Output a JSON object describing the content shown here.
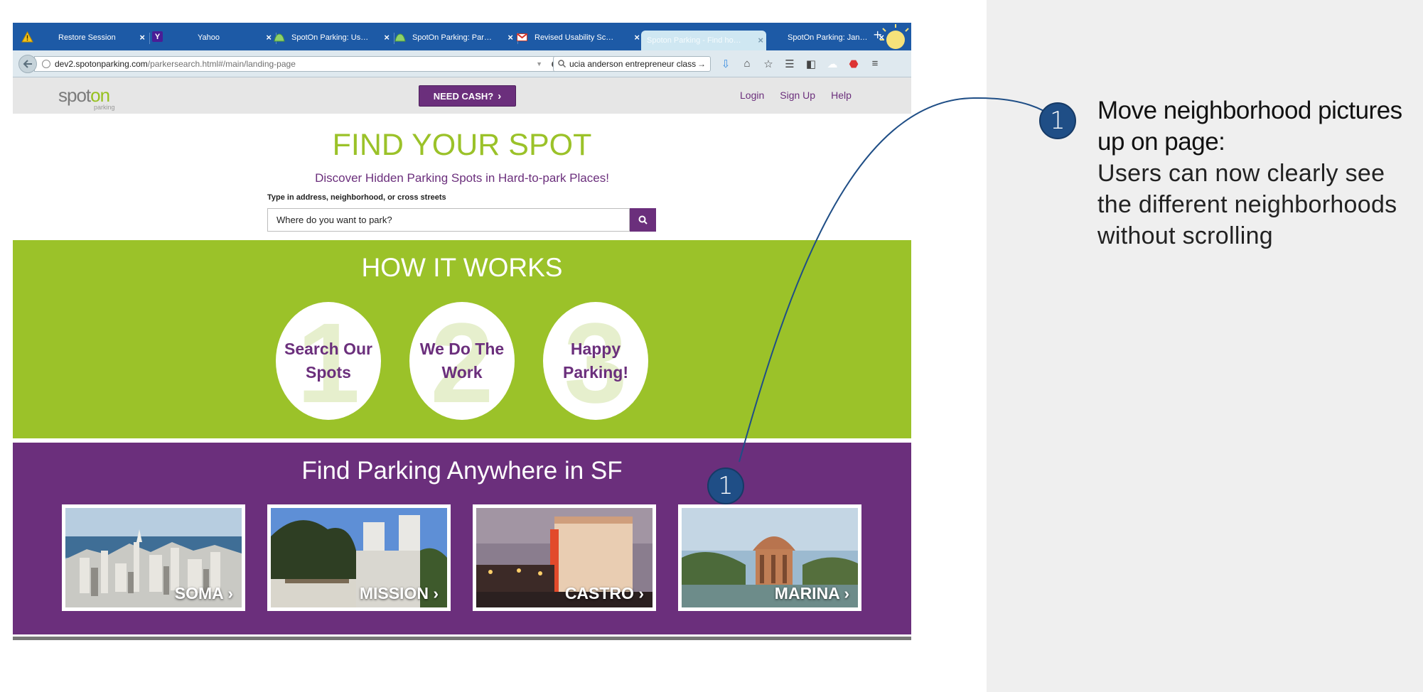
{
  "browser": {
    "tabs": [
      {
        "label": "Restore Session",
        "icon": "warning-icon"
      },
      {
        "label": "Yahoo",
        "icon": "yahoo-icon"
      },
      {
        "label": "SpotOn Parking: Us…",
        "icon": "spoton-icon"
      },
      {
        "label": "SpotOn Parking: Par…",
        "icon": "spoton-icon"
      },
      {
        "label": "Revised Usability Sc…",
        "icon": "gmail-icon"
      },
      {
        "label": "Spoton Parking - Find ho…",
        "icon": ""
      },
      {
        "label": "SpotOn Parking: Jan…",
        "icon": ""
      }
    ],
    "new_tab": "+",
    "url_host": "dev2.spotonparking.com",
    "url_path": "/parkersearch.html#/main/landing-page",
    "search_value": "ucia anderson entrepreneur class"
  },
  "site": {
    "logo_spot": "spot",
    "logo_on": "on",
    "logo_sub": "parking",
    "need_cash": "NEED CASH?",
    "links": {
      "login": "Login",
      "signup": "Sign Up",
      "help": "Help"
    },
    "hero_title": "FIND YOUR SPOT",
    "hero_subtitle": "Discover Hidden Parking Spots in Hard-to-park Places!",
    "search_label": "Type in address, neighborhood, or cross streets",
    "search_placeholder": "Where do you want to park?",
    "how_title": "HOW IT WORKS",
    "steps": [
      {
        "number": "1",
        "line1": "Search Our",
        "line2": "Spots"
      },
      {
        "number": "2",
        "line1": "We Do The",
        "line2": "Work"
      },
      {
        "number": "3",
        "line1": "Happy",
        "line2": "Parking!"
      }
    ],
    "hood_title": "Find Parking Anywhere in SF",
    "neighborhoods": [
      {
        "label": "SOMA"
      },
      {
        "label": "MISSION"
      },
      {
        "label": "CASTRO"
      },
      {
        "label": "MARINA"
      }
    ]
  },
  "annotation": {
    "marker_number": "1",
    "title": "Move neighborhood pictures up on page:",
    "body": "Users can now clearly see the different neighborhoods without scrolling"
  },
  "colors": {
    "brand_purple": "#6b2f7c",
    "brand_green": "#9bc229",
    "marker_blue": "#1f4e86"
  }
}
